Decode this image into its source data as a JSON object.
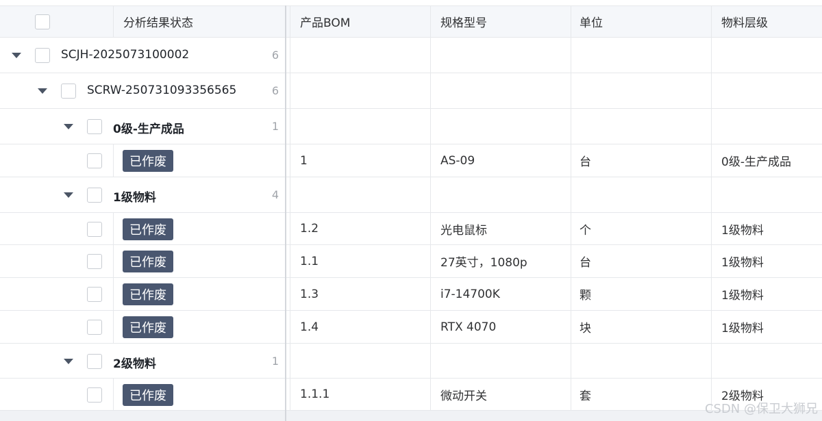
{
  "header": {
    "col_status": "分析结果状态",
    "col_bom": "产品BOM",
    "col_spec": "规格型号",
    "col_unit": "单位",
    "col_level": "物料层级"
  },
  "rows": [
    {
      "type": "group",
      "level": 1,
      "label": "SCJH-2025073100002",
      "count": "6"
    },
    {
      "type": "group",
      "level": 2,
      "label": "SCRW-250731093356565",
      "count": "6"
    },
    {
      "type": "group",
      "level": 3,
      "label": "0级-生产成品",
      "count": "1"
    },
    {
      "type": "data",
      "status": "已作废",
      "bom": "1",
      "spec": "AS-09",
      "unit": "台",
      "level": "0级-生产成品"
    },
    {
      "type": "group",
      "level": 3,
      "label": "1级物料",
      "count": "4"
    },
    {
      "type": "data",
      "status": "已作废",
      "bom": "1.2",
      "spec": "光电鼠标",
      "unit": "个",
      "level": "1级物料"
    },
    {
      "type": "data",
      "status": "已作废",
      "bom": "1.1",
      "spec": "27英寸，1080p",
      "unit": "台",
      "level": "1级物料"
    },
    {
      "type": "data",
      "status": "已作废",
      "bom": "1.3",
      "spec": "i7-14700K",
      "unit": "颗",
      "level": "1级物料"
    },
    {
      "type": "data",
      "status": "已作废",
      "bom": "1.4",
      "spec": "RTX 4070",
      "unit": "块",
      "level": "1级物料"
    },
    {
      "type": "group",
      "level": 3,
      "label": "2级物料",
      "count": "1"
    },
    {
      "type": "data",
      "status": "已作废",
      "bom": "1.1.1",
      "spec": "微动开关",
      "unit": "套",
      "level": "2级物料"
    }
  ],
  "watermark": "CSDN @保卫大狮兄"
}
